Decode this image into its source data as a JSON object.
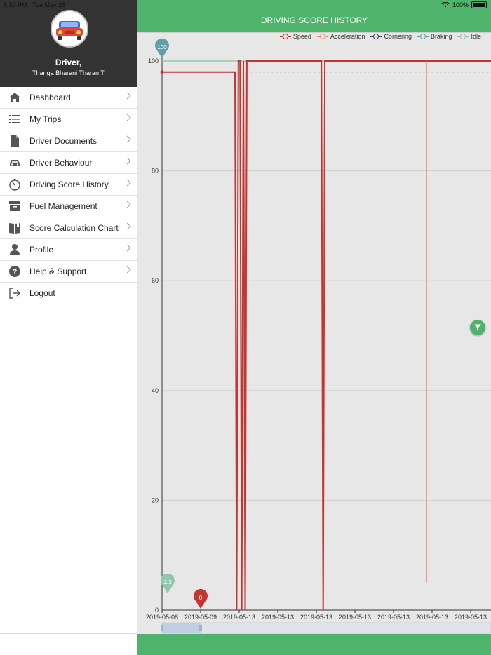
{
  "status_bar": {
    "time": "5:30 PM",
    "date": "Tue May 28",
    "battery": "100%"
  },
  "sidebar": {
    "driver_label": "Driver,",
    "driver_name": "Thanga Bharani Tharan T",
    "items": [
      {
        "label": "Dashboard",
        "icon": "home-icon",
        "chevron": true
      },
      {
        "label": "My Trips",
        "icon": "list-icon",
        "chevron": true
      },
      {
        "label": "Driver Documents",
        "icon": "document-icon",
        "chevron": true
      },
      {
        "label": "Driver Behaviour",
        "icon": "car-icon",
        "chevron": true
      },
      {
        "label": "Driving Score History",
        "icon": "timer-icon",
        "chevron": true
      },
      {
        "label": "Fuel Management",
        "icon": "archive-icon",
        "chevron": true
      },
      {
        "label": "Score Calculation Chart",
        "icon": "book-icon",
        "chevron": true
      },
      {
        "label": "Profile",
        "icon": "person-icon",
        "chevron": true
      },
      {
        "label": "Help & Support",
        "icon": "help-icon",
        "chevron": true
      },
      {
        "label": "Logout",
        "icon": "logout-icon",
        "chevron": false
      }
    ]
  },
  "header": {
    "title": "DRIVING SCORE HISTORY"
  },
  "colors": {
    "brand_green": "#4fb36b",
    "sidebar_dark": "#333333",
    "speed": "#c23531",
    "acceleration": "#e8896a",
    "cornering": "#2f4554",
    "braking": "#61a0a8",
    "idle": "#91c7ae"
  },
  "chart_data": {
    "type": "line",
    "legend": [
      {
        "name": "Speed",
        "color": "#c23531"
      },
      {
        "name": "Acceleration",
        "color": "#e8896a"
      },
      {
        "name": "Cornering",
        "color": "#2f4554"
      },
      {
        "name": "Braking",
        "color": "#61a0a8"
      },
      {
        "name": "Idle",
        "color": "#91c7ae"
      }
    ],
    "legend_position": "top-right",
    "ylim": [
      0,
      100
    ],
    "yticks": [
      0,
      20,
      40,
      60,
      80,
      100
    ],
    "x_tick_labels": [
      "2019-05-08",
      "2019-05-09",
      "2019-05-13",
      "2019-05-13",
      "2019-05-13",
      "2019-05-13",
      "2019-05-13",
      "2019-05-13",
      "2019-05-13"
    ],
    "speed_series": [
      98,
      98,
      98,
      98,
      98,
      98,
      98,
      98,
      98,
      98,
      98,
      98,
      98,
      98,
      98,
      98,
      98,
      98,
      98,
      98,
      98,
      98,
      98,
      98,
      98,
      98,
      98,
      98,
      98,
      98,
      98,
      98,
      98,
      98,
      98,
      98,
      98,
      98,
      98,
      98,
      98,
      98,
      98,
      98,
      0,
      100,
      100,
      0,
      100,
      0,
      100,
      100,
      100,
      100,
      100,
      100,
      100,
      100,
      100,
      100,
      100,
      100,
      100,
      100,
      100,
      100,
      100,
      100,
      100,
      100,
      100,
      100,
      100,
      100,
      100,
      100,
      100,
      100,
      100,
      100,
      100,
      100,
      100,
      100,
      100,
      100,
      100,
      100,
      100,
      100,
      100,
      100,
      100,
      100,
      100,
      0,
      100,
      100,
      100,
      100,
      100,
      100,
      100,
      100,
      100,
      100,
      100,
      100,
      100,
      100,
      100,
      100,
      100,
      100,
      100,
      100,
      100,
      100,
      100,
      100,
      100,
      100,
      100,
      100,
      100,
      100,
      100,
      100,
      100,
      100,
      100,
      100,
      100,
      100,
      100,
      100,
      100,
      100,
      100,
      100,
      100,
      100,
      100,
      100,
      100,
      100,
      100,
      100,
      100,
      100,
      100,
      100,
      100,
      100,
      100,
      100,
      100,
      100,
      100,
      100,
      100,
      100,
      100,
      100,
      100,
      100,
      100,
      100,
      100,
      100,
      100,
      100,
      100,
      100,
      100,
      100,
      100,
      100,
      100,
      100,
      100,
      100,
      100,
      100,
      100,
      100,
      100,
      100,
      100,
      100,
      100,
      100,
      100,
      100,
      100
    ],
    "drops": [
      {
        "series": "Speed",
        "x_index": 1,
        "value": 0
      },
      {
        "series": "Speed",
        "x_index": 2,
        "value": 0
      },
      {
        "series": "Speed",
        "x_index": 3,
        "value": 0
      },
      {
        "series": "Speed",
        "x_index": 4,
        "value": 0
      },
      {
        "series": "Speed",
        "x_index": 5,
        "value": 0
      },
      {
        "series": "Speed",
        "x_index": 6,
        "value": 0
      },
      {
        "series": "Speed",
        "x_index": 7,
        "value": 0
      },
      {
        "series": "Speed",
        "x_index": 8,
        "value": 0
      },
      {
        "series": "Speed",
        "x_index": 9,
        "value": 0
      },
      {
        "series": "Speed",
        "x_index": 10,
        "value": 0
      },
      {
        "series": "Speed",
        "x_index": 11,
        "value": 0
      },
      {
        "series": "Speed",
        "x_index": 12,
        "value": 0
      },
      {
        "series": "Speed",
        "x_index": 13,
        "value": 0
      },
      {
        "series": "Speed",
        "x_index": 14,
        "value": 0
      },
      {
        "series": "Speed",
        "x_index": 15,
        "value": 0
      }
    ],
    "speed_avg_line": 98,
    "markers": [
      {
        "label": "100",
        "series": "Braking",
        "value": 100
      },
      {
        "label": "0",
        "series": "Speed",
        "value": 0
      },
      {
        "label": "2.3",
        "series": "Idle",
        "value": 2.3
      }
    ],
    "grid": true
  }
}
